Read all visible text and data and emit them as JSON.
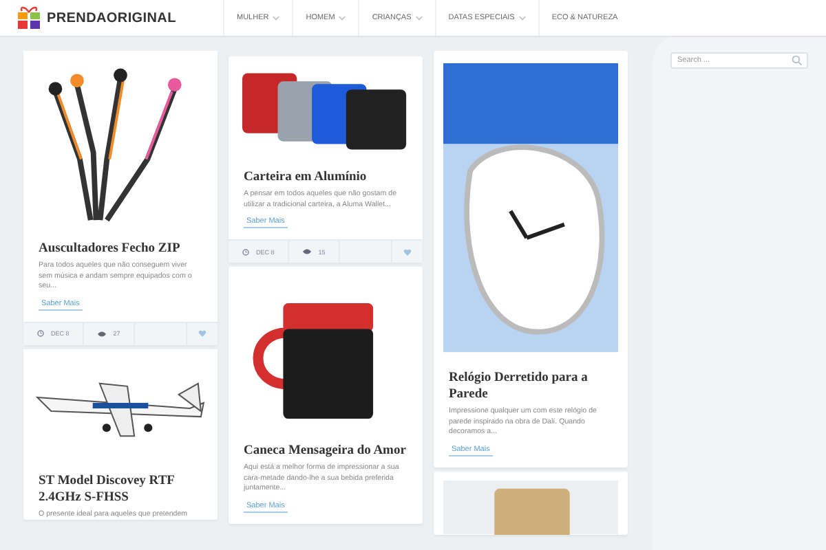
{
  "header": {
    "logo": "PRENDAORIGINAL",
    "nav": [
      {
        "label": "MULHER",
        "has_submenu": true
      },
      {
        "label": "HOMEM",
        "has_submenu": true
      },
      {
        "label": "CRIANÇAS",
        "has_submenu": true
      },
      {
        "label": "DATAS ESPECIAIS",
        "has_submenu": true
      },
      {
        "label": "ECO & NATUREZA",
        "has_submenu": false
      }
    ]
  },
  "columns": [
    [
      {
        "title": "Auscultadores Fecho ZIP",
        "excerpt": "Para todos aqueles que não conseguem viver sem música e andam sempre equipados com o seu...",
        "link": "Saber Mais",
        "date": "DEC 8",
        "views": "27",
        "kind": "earphones"
      },
      {
        "title": "ST Model Discovey RTF 2.4GHz S-FHSS",
        "excerpt": "O presente ideal para aqueles que pretendem",
        "kind": "plane"
      }
    ],
    [
      {
        "title": "Carteira em Alumínio",
        "excerpt": "A pensar em todos aqueles que não gostam de utilizar a tradicional carteira, a Aluma Wallet...",
        "link": "Saber Mais",
        "date": "DEC 8",
        "views": "15",
        "kind": "wallets"
      },
      {
        "title": "Caneca Mensageira do Amor",
        "excerpt": "Aqui está a melhor forma de impressionar a sua cara-metade dando-lhe a sua bebida preferida juntamente...",
        "link": "Saber Mais",
        "kind": "mug"
      }
    ],
    [
      {
        "title": "Relógio Derretido para a Parede",
        "excerpt": "Impressione qualquer um com este relógio de parede inspirado na obra de Dalí. Quando decoramos a...",
        "link": "Saber Mais",
        "kind": "clock"
      },
      {
        "kind": "cork"
      }
    ]
  ],
  "search": {
    "placeholder": "Search ..."
  }
}
